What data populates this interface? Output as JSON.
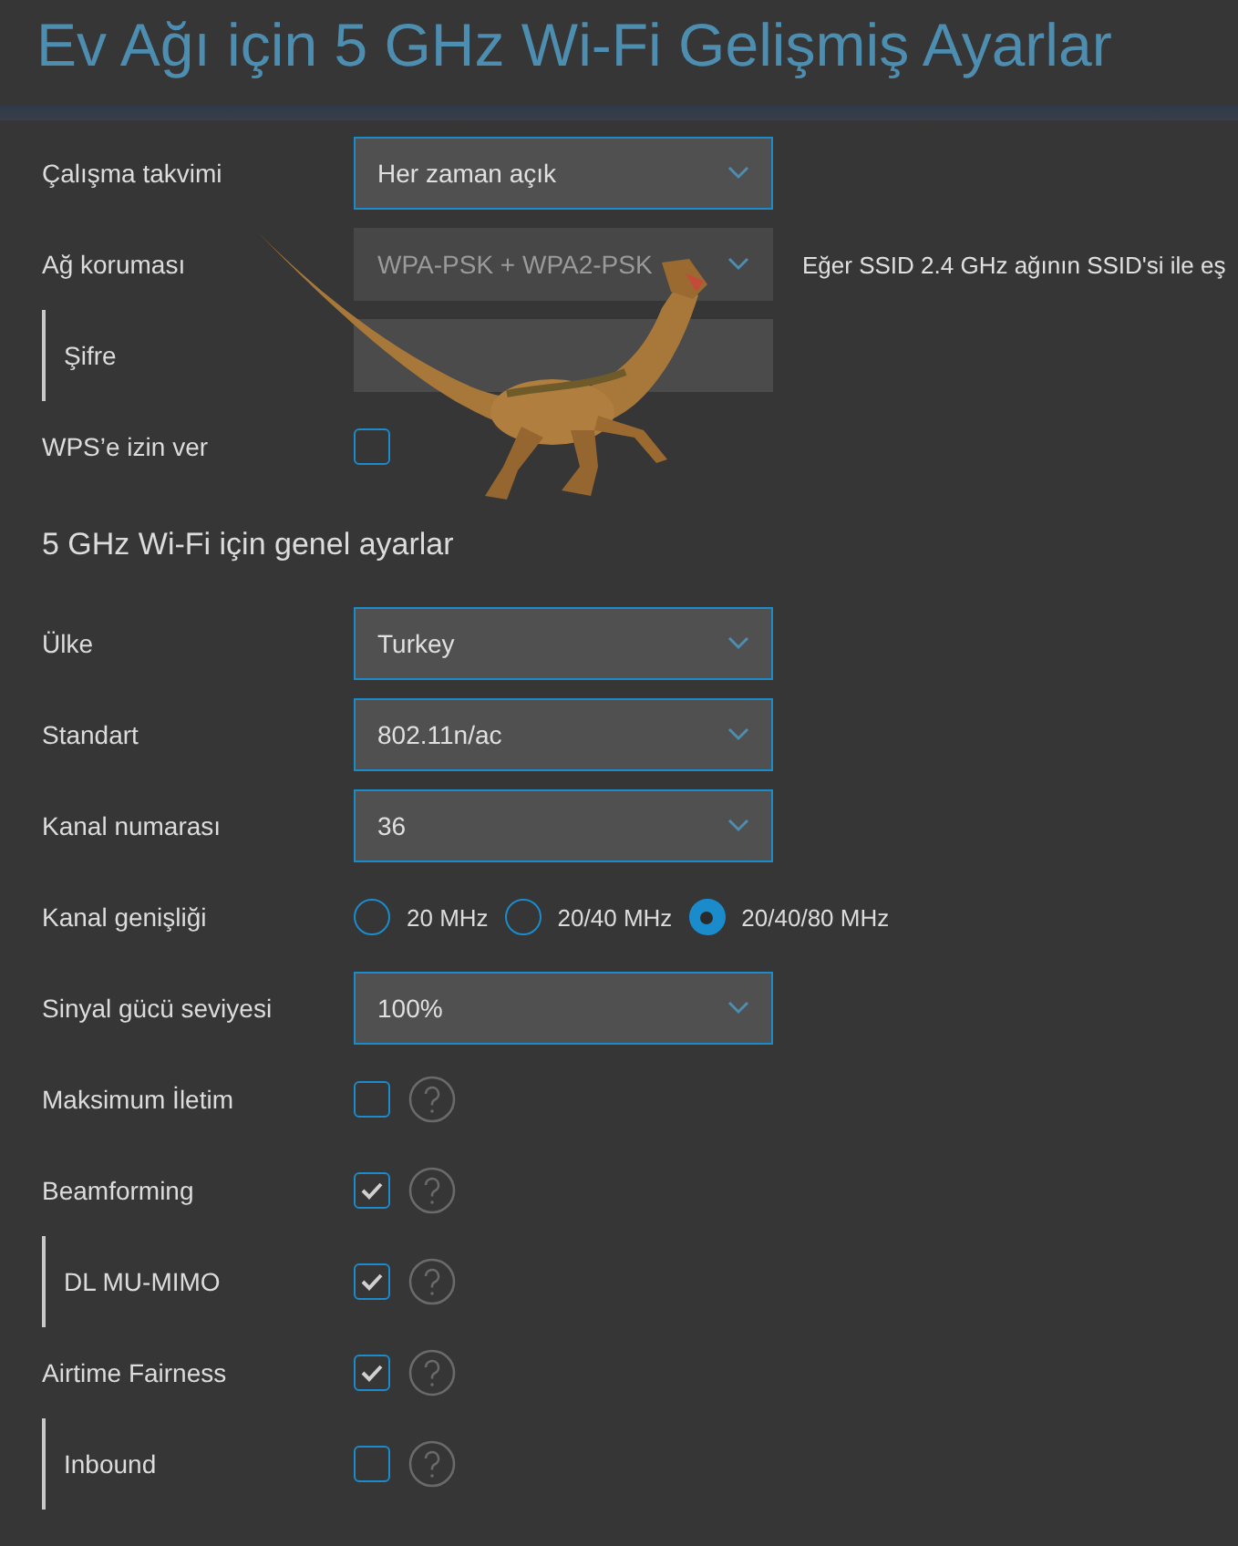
{
  "title": "Ev Ağı için 5 GHz Wi-Fi Gelişmiş Ayarlar",
  "rows": [
    {
      "kind": "select",
      "label": "Çalışma takvimi",
      "value": "Her zaman açık",
      "disabled": false,
      "sub": false
    },
    {
      "kind": "select",
      "label": "Ağ koruması",
      "value": "WPA-PSK + WPA2-PSK",
      "disabled": true,
      "sub": false,
      "note": "Eğer SSID 2.4 GHz ağının SSID'si ile eş"
    },
    {
      "kind": "password",
      "label": "Şifre",
      "sub": true
    },
    {
      "kind": "checkbox",
      "label": "WPS’e izin ver",
      "checked": false,
      "help": false,
      "sub": false
    },
    {
      "kind": "heading",
      "label": "5 GHz Wi-Fi için genel ayarlar"
    },
    {
      "kind": "select",
      "label": "Ülke",
      "value": "Turkey",
      "disabled": false,
      "sub": false
    },
    {
      "kind": "select",
      "label": "Standart",
      "value": "802.11n/ac",
      "disabled": false,
      "sub": false
    },
    {
      "kind": "select",
      "label": "Kanal numarası",
      "value": "36",
      "disabled": false,
      "sub": false
    },
    {
      "kind": "radio",
      "label": "Kanal genişliği",
      "sub": false,
      "options": [
        {
          "label": "20 MHz",
          "selected": false
        },
        {
          "label": "20/40 MHz",
          "selected": false
        },
        {
          "label": "20/40/80 MHz",
          "selected": true
        }
      ]
    },
    {
      "kind": "select",
      "label": "Sinyal gücü seviyesi",
      "value": "100%",
      "disabled": false,
      "sub": false
    },
    {
      "kind": "checkbox",
      "label": "Maksimum İletim",
      "checked": false,
      "help": true,
      "sub": false
    },
    {
      "kind": "checkbox",
      "label": "Beamforming",
      "checked": true,
      "help": true,
      "sub": false
    },
    {
      "kind": "checkbox",
      "label": "DL MU-MIMO",
      "checked": true,
      "help": true,
      "sub": true
    },
    {
      "kind": "checkbox",
      "label": "Airtime Fairness",
      "checked": true,
      "help": true,
      "sub": false
    },
    {
      "kind": "checkbox",
      "label": "Inbound",
      "checked": false,
      "help": true,
      "sub": true
    }
  ]
}
